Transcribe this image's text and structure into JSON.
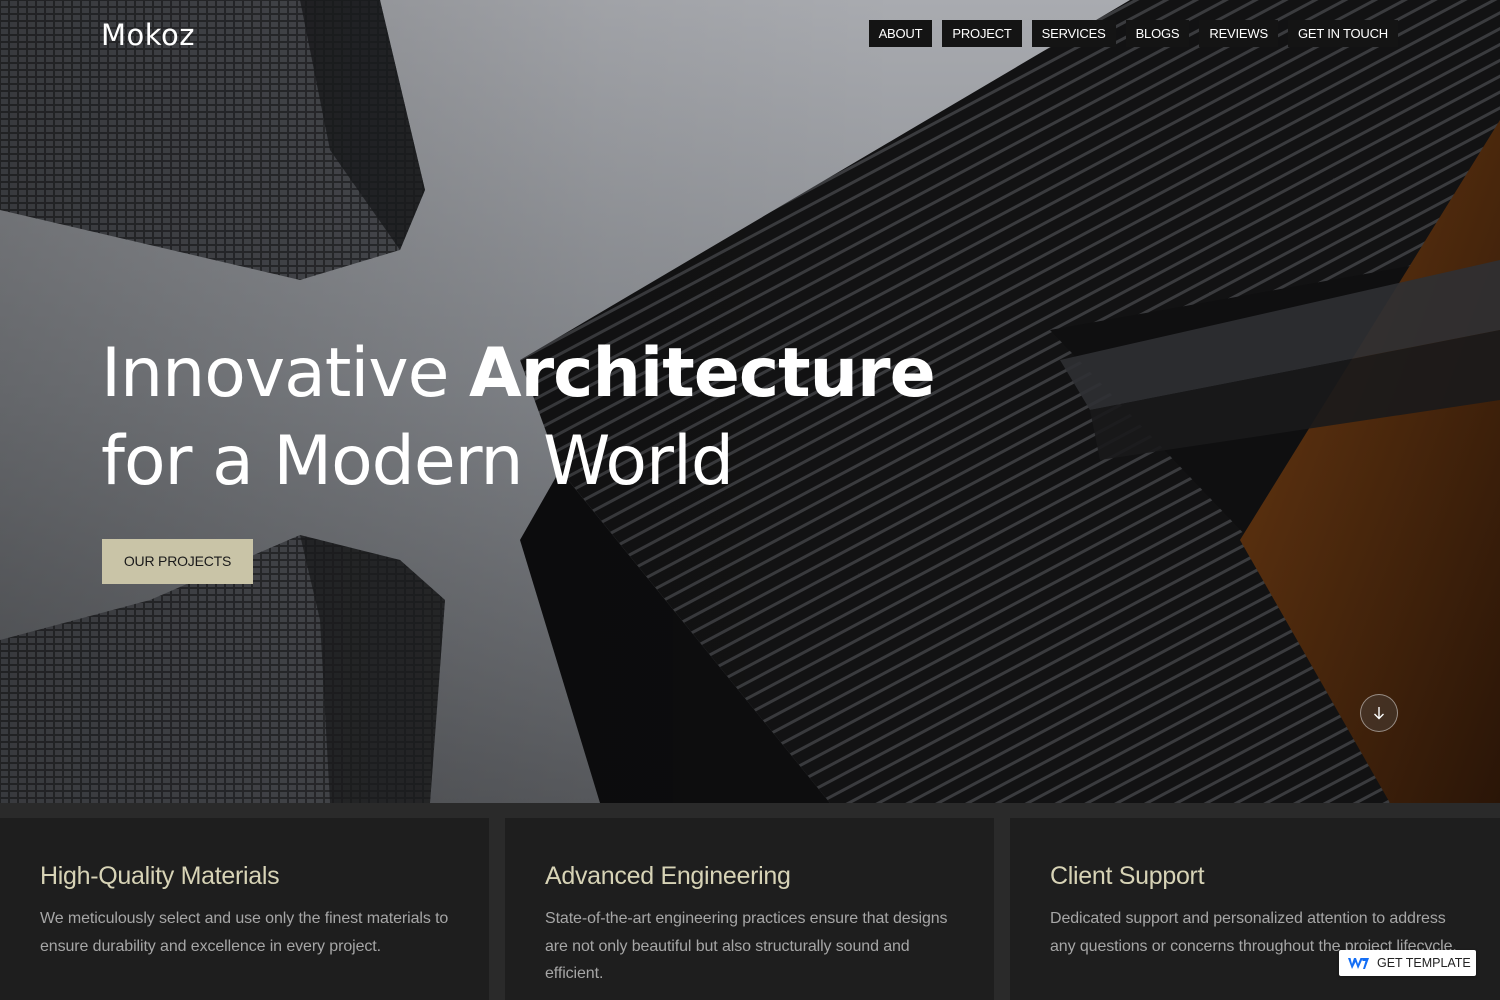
{
  "brand": {
    "logo": "Mokoz"
  },
  "nav": {
    "items": [
      {
        "label": "ABOUT"
      },
      {
        "label": "PROJECT"
      },
      {
        "label": "SERVICES"
      },
      {
        "label": "BLOGS"
      },
      {
        "label": "REVIEWS"
      },
      {
        "label": "GET IN TOUCH"
      }
    ]
  },
  "hero": {
    "headline_light": "Innovative ",
    "headline_bold": "Architecture",
    "headline_line2": "for a Modern World",
    "cta_label": "OUR PROJECTS"
  },
  "features": [
    {
      "title": "High-Quality Materials",
      "text": "We meticulously select and use only the finest materials to ensure durability and excellence in every project."
    },
    {
      "title": "Advanced Engineering",
      "text": "State-of-the-art engineering practices ensure that  designs are not only beautiful but also structurally sound and efficient."
    },
    {
      "title": "Client Support",
      "text": "Dedicated support and personalized attention to address any questions or concerns throughout the project lifecycle."
    }
  ],
  "badge": {
    "label": "GET TEMPLATE"
  },
  "colors": {
    "accent": "#c9c4a7",
    "card_title": "#d7d3b6",
    "card_bg": "#1e1e1e",
    "nav_bg": "#141414"
  },
  "icons": {
    "scroll": "arrow-down-icon",
    "badge": "webflow-icon"
  }
}
